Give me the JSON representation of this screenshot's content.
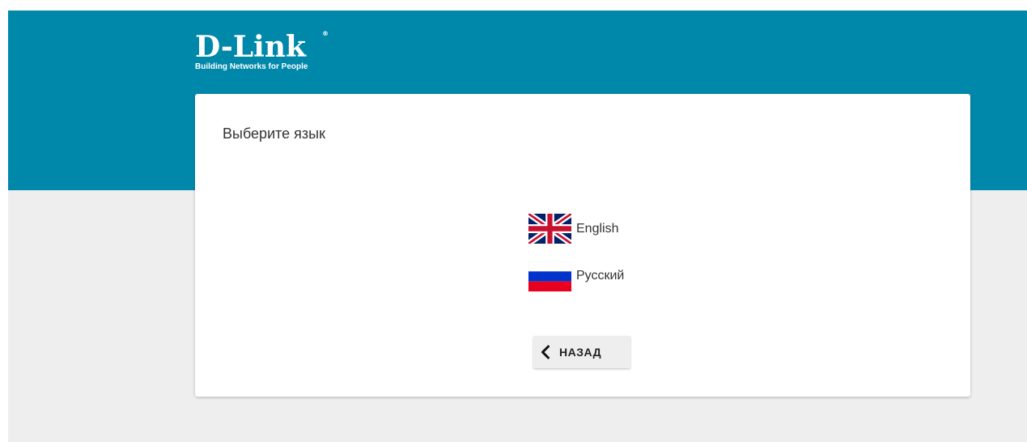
{
  "header": {
    "brand": "D-Link",
    "brand_mark": "®",
    "tagline": "Building Networks for People",
    "background_color": "#0088aa"
  },
  "card": {
    "title": "Выберите язык",
    "languages": [
      {
        "label": "English",
        "icon": "uk-flag-icon"
      },
      {
        "label": "Русский",
        "icon": "russia-flag-icon"
      }
    ],
    "back_button": {
      "label": "НАЗАД",
      "icon": "chevron-left-icon"
    }
  },
  "colors": {
    "page_background": "#eeeeee",
    "card_background": "#ffffff",
    "text": "#333333"
  }
}
